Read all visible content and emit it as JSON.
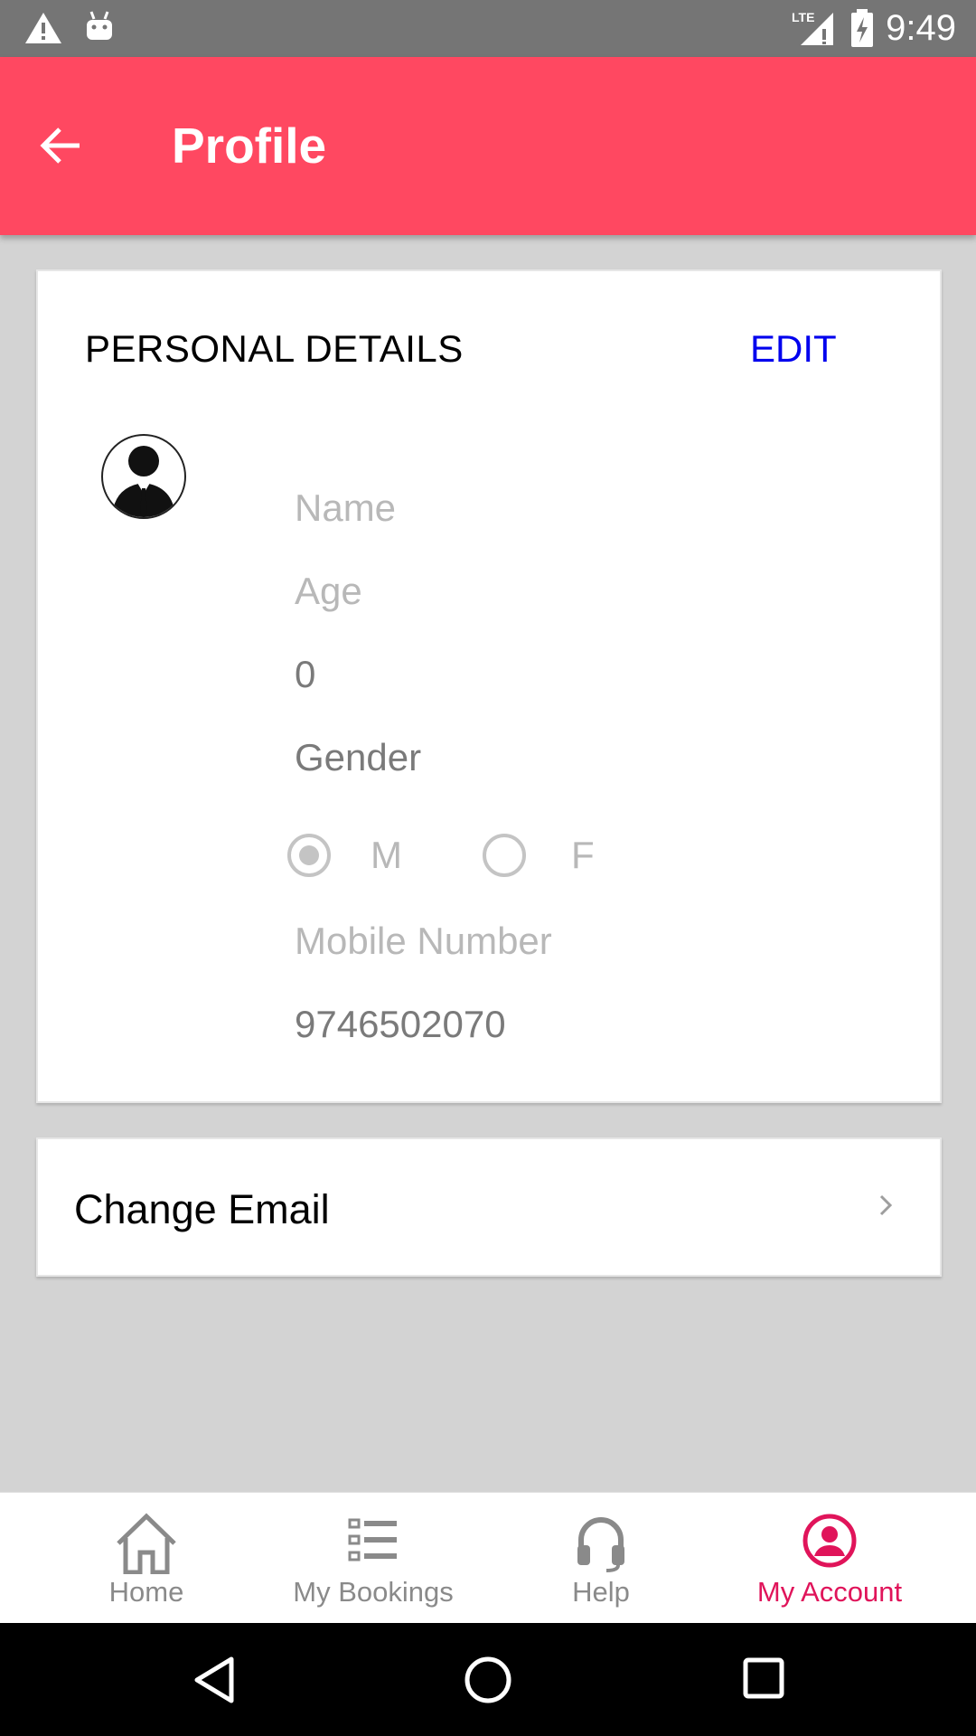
{
  "status_bar": {
    "time": "9:49",
    "icons": [
      "warning-icon",
      "android-icon",
      "lte-signal-icon",
      "battery-charging-icon"
    ],
    "network_label": "LTE"
  },
  "app_bar": {
    "title": "Profile",
    "back_icon": "arrow-back-icon",
    "background_color": "#ff4861"
  },
  "personal_details": {
    "heading": "PERSONAL DETAILS",
    "edit_label": "EDIT",
    "avatar_icon": "person-avatar-icon",
    "name_placeholder": "Name",
    "age_placeholder": "Age",
    "age_value": "0",
    "gender_label": "Gender",
    "gender_options": [
      {
        "label": "M",
        "selected": true
      },
      {
        "label": "F",
        "selected": false
      }
    ],
    "mobile_placeholder": "Mobile Number",
    "mobile_value": "9746502070"
  },
  "change_email": {
    "label": "Change Email",
    "chevron_icon": "chevron-right-icon"
  },
  "bottom_nav": {
    "items": [
      {
        "label": "Home",
        "icon": "home-icon",
        "active": false
      },
      {
        "label": "My Bookings",
        "icon": "list-icon",
        "active": false
      },
      {
        "label": "Help",
        "icon": "headset-icon",
        "active": false
      },
      {
        "label": "My Account",
        "icon": "account-circle-icon",
        "active": true
      }
    ],
    "active_color": "#e0145a",
    "inactive_color": "#8a8a8a"
  },
  "system_nav": {
    "icons": [
      "back-triangle-icon",
      "home-circle-icon",
      "recents-square-icon"
    ]
  }
}
